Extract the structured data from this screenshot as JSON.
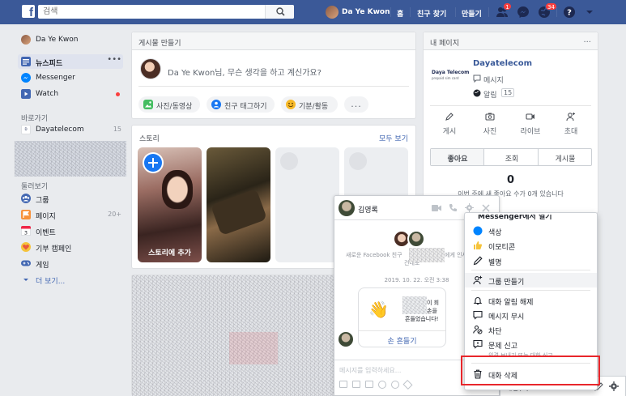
{
  "topbar": {
    "logo": "f",
    "search_placeholder": "검색",
    "user_name": "Da Ye Kwon",
    "home": "홈",
    "find_friends": "친구 찾기",
    "create": "만들기",
    "friend_requests_badge": "1",
    "notifications_badge": "34",
    "accent_color": "#3b5998"
  },
  "leftnav": {
    "user_name": "Da Ye Kwon",
    "items": [
      {
        "label": "뉴스피드",
        "icon": "newsfeed-icon"
      },
      {
        "label": "Messenger",
        "icon": "messenger-icon"
      },
      {
        "label": "Watch",
        "icon": "watch-icon"
      }
    ],
    "shortcuts_heading": "바로가기",
    "shortcut_page": {
      "label": "Dayatelecom",
      "count": "15"
    },
    "explore_heading": "둘러보기",
    "explore": [
      {
        "label": "그룹",
        "count": ""
      },
      {
        "label": "페이지",
        "count": "20+"
      },
      {
        "label": "이벤트",
        "count": ""
      },
      {
        "label": "기부 캠페인",
        "count": ""
      },
      {
        "label": "게임",
        "count": ""
      }
    ],
    "see_more": "더 보기..."
  },
  "composer": {
    "title": "게시물 만들기",
    "placeholder": "Da Ye Kwon님, 무슨 생각을 하고 계신가요?",
    "actions": [
      "사진/동영상",
      "친구 태그하기",
      "기분/활동"
    ],
    "more": "..."
  },
  "stories": {
    "title": "스토리",
    "see_all": "모두 보기",
    "add_story": "스토리에 추가"
  },
  "my_pages": {
    "title": "내 페이지",
    "more": "...",
    "page_name": "Dayatelecom",
    "logo_text": "Daya Telecom",
    "logo_sub": "prepaid sim card",
    "messages": "메시지",
    "notifications": "알림",
    "notifications_count": "15",
    "actions": [
      "게시",
      "사진",
      "라이브",
      "초대"
    ],
    "tabs": [
      "좋아요",
      "조회",
      "게시물"
    ],
    "likes_count": "0",
    "likes_caption": "이번 주에 새 좋아요 수가 0개 있습니다"
  },
  "chat": {
    "name": "김영록",
    "intro_line1": "새로운 Facebook 친구",
    "intro_line2": "에게 인사",
    "intro_line3": "건네보",
    "timestamp": "2019. 10. 22. 오전 3:38",
    "wave_text_1": "이 회",
    "wave_text_2": "손을",
    "wave_text_3": "흔들었습니다!",
    "wave_button": "손 흔들기",
    "input_placeholder": "메시지를 입력하세요...",
    "settings_label": "채팅(3)"
  },
  "menu": {
    "top_partial": "Messenger에서 열기",
    "items": [
      {
        "label": "색상",
        "icon": "color-dot-icon"
      },
      {
        "label": "이모티콘",
        "icon": "thumbs-up-icon"
      },
      {
        "label": "별명",
        "icon": "pencil-icon"
      },
      {
        "label": "그룹 만들기",
        "icon": "add-person-icon"
      },
      {
        "label": "대화 알림 해제",
        "icon": "bell-icon"
      },
      {
        "label": "메시지 무시",
        "icon": "ignore-icon"
      },
      {
        "label": "차단",
        "icon": "block-icon"
      },
      {
        "label": "문제 신고",
        "icon": "report-icon"
      },
      {
        "label": "대화 삭제",
        "icon": "trash-icon"
      }
    ],
    "report_sub": "의견 보내기 또는 대화 신고"
  },
  "colors": {
    "brand": "#3b5998",
    "messenger_blue": "#0084ff",
    "highlight": "#e8262b"
  }
}
